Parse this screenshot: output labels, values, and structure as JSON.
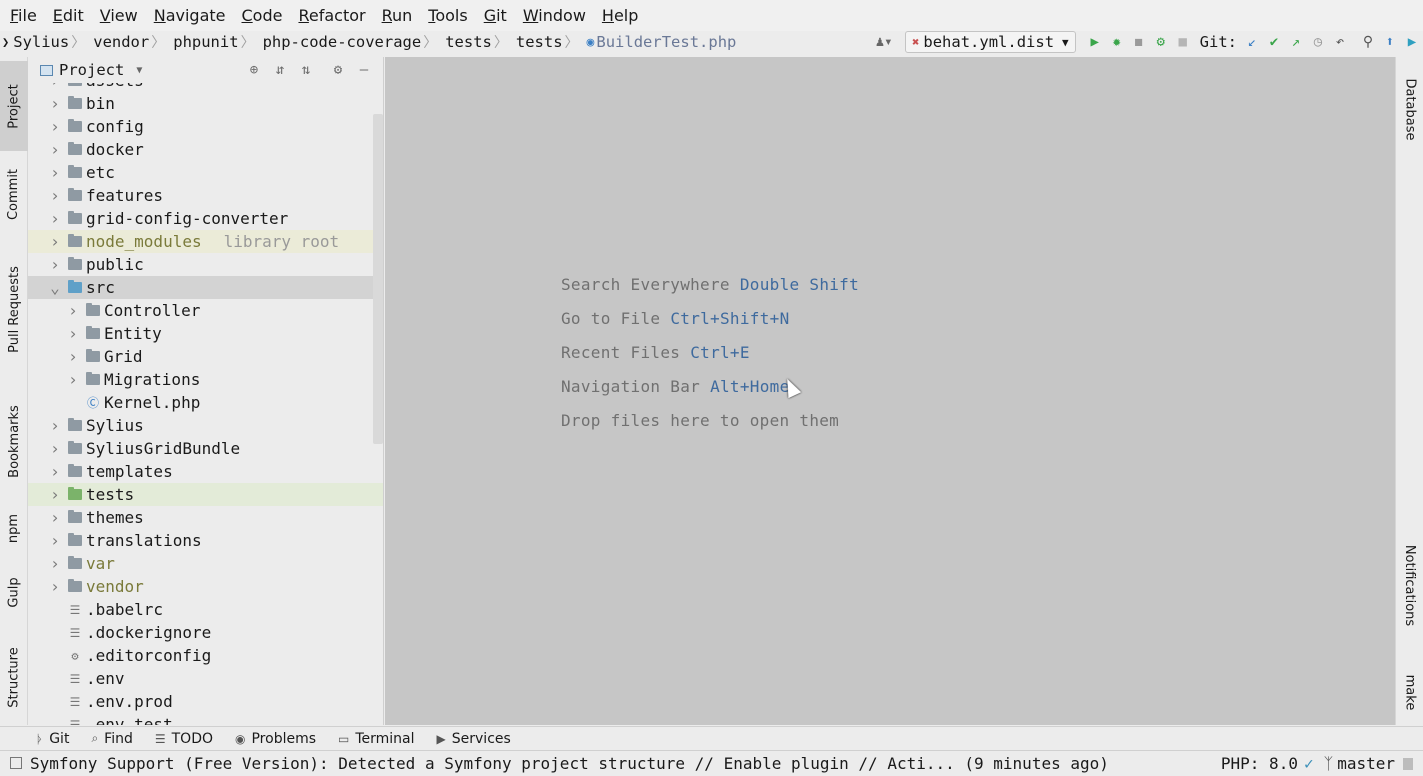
{
  "menu": [
    "File",
    "Edit",
    "View",
    "Navigate",
    "Code",
    "Refactor",
    "Run",
    "Tools",
    "Git",
    "Window",
    "Help"
  ],
  "breadcrumb": [
    "Sylius",
    "vendor",
    "phpunit",
    "php-code-coverage",
    "tests",
    "tests"
  ],
  "breadcrumb_file": "BuilderTest.php",
  "run_config": "behat.yml.dist",
  "git_label": "Git:",
  "left_tabs": [
    "Project",
    "Commit",
    "Pull Requests",
    "Bookmarks",
    "npm",
    "Gulp",
    "Structure"
  ],
  "right_tabs": [
    "Database",
    "Notifications",
    "make"
  ],
  "project_panel": {
    "title": "Project",
    "tree": [
      {
        "label": "assets",
        "type": "folder",
        "depth": 0,
        "expanded": false
      },
      {
        "label": "bin",
        "type": "folder",
        "depth": 0,
        "expanded": false
      },
      {
        "label": "config",
        "type": "folder",
        "depth": 0,
        "expanded": false
      },
      {
        "label": "docker",
        "type": "folder",
        "depth": 0,
        "expanded": false
      },
      {
        "label": "etc",
        "type": "folder",
        "depth": 0,
        "expanded": false
      },
      {
        "label": "features",
        "type": "folder",
        "depth": 0,
        "expanded": false
      },
      {
        "label": "grid-config-converter",
        "type": "folder",
        "depth": 0,
        "expanded": false
      },
      {
        "label": "node_modules",
        "type": "library",
        "depth": 0,
        "expanded": false,
        "hint": "library root"
      },
      {
        "label": "public",
        "type": "folder",
        "depth": 0,
        "expanded": false
      },
      {
        "label": "src",
        "type": "source",
        "depth": 0,
        "expanded": true,
        "selected": true
      },
      {
        "label": "Controller",
        "type": "folder",
        "depth": 1,
        "expanded": false
      },
      {
        "label": "Entity",
        "type": "folder",
        "depth": 1,
        "expanded": false
      },
      {
        "label": "Grid",
        "type": "folder",
        "depth": 1,
        "expanded": false
      },
      {
        "label": "Migrations",
        "type": "folder",
        "depth": 1,
        "expanded": false
      },
      {
        "label": "Kernel.php",
        "type": "php",
        "depth": 1
      },
      {
        "label": "Sylius",
        "type": "folder",
        "depth": 0,
        "expanded": false
      },
      {
        "label": "SyliusGridBundle",
        "type": "folder",
        "depth": 0,
        "expanded": false
      },
      {
        "label": "templates",
        "type": "folder",
        "depth": 0,
        "expanded": false
      },
      {
        "label": "tests",
        "type": "test",
        "depth": 0,
        "expanded": false
      },
      {
        "label": "themes",
        "type": "folder",
        "depth": 0,
        "expanded": false
      },
      {
        "label": "translations",
        "type": "folder",
        "depth": 0,
        "expanded": false
      },
      {
        "label": "var",
        "type": "excluded",
        "depth": 0,
        "expanded": false
      },
      {
        "label": "vendor",
        "type": "excluded",
        "depth": 0,
        "expanded": false
      },
      {
        "label": ".babelrc",
        "type": "file",
        "depth": 0
      },
      {
        "label": ".dockerignore",
        "type": "file",
        "depth": 0
      },
      {
        "label": ".editorconfig",
        "type": "config",
        "depth": 0
      },
      {
        "label": ".env",
        "type": "file",
        "depth": 0
      },
      {
        "label": ".env.prod",
        "type": "file",
        "depth": 0
      },
      {
        "label": ".env.test",
        "type": "file",
        "depth": 0
      }
    ]
  },
  "editor_hints": [
    {
      "text": "Search Everywhere",
      "key": "Double Shift"
    },
    {
      "text": "Go to File",
      "key": "Ctrl+Shift+N"
    },
    {
      "text": "Recent Files",
      "key": "Ctrl+E"
    },
    {
      "text": "Navigation Bar",
      "key": "Alt+Home"
    },
    {
      "text": "Drop files here to open them",
      "key": ""
    }
  ],
  "bottom_tabs": [
    {
      "label": "Git",
      "icon": "git-branch-icon"
    },
    {
      "label": "Find",
      "icon": "search-icon"
    },
    {
      "label": "TODO",
      "icon": "todo-list-icon"
    },
    {
      "label": "Problems",
      "icon": "problems-icon"
    },
    {
      "label": "Terminal",
      "icon": "terminal-icon"
    },
    {
      "label": "Services",
      "icon": "services-icon"
    }
  ],
  "status": {
    "message": "Symfony Support (Free Version): Detected a Symfony project structure // Enable plugin // Acti... (9 minutes ago)",
    "php": "PHP: 8.0",
    "branch": "master"
  }
}
